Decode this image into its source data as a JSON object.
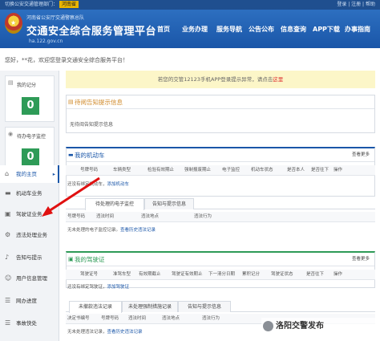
{
  "topbar": {
    "left": "切换公安交通管理部门：",
    "province": "河南省",
    "right": "登录 | 注册 | 帮助"
  },
  "header": {
    "subtitle": "河南省公安厅交通警察总队",
    "title": "交通安全综合服务管理平台",
    "url": "ha.122.gov.cn",
    "nav": [
      "首页",
      "业务办理",
      "服务导航",
      "公告公布",
      "信息查询",
      "APP下载",
      "办事指南"
    ]
  },
  "welcome": "您好，**花，欢迎您登录交通安全综合服务平台！",
  "sidebar": {
    "score_card": {
      "label": "我的记分",
      "value": "0"
    },
    "camera_card": {
      "label": "待办电子监控",
      "value": "0"
    },
    "items": [
      {
        "label": "我的主页",
        "icon": "home-icon",
        "active": true
      },
      {
        "label": "机动车业务",
        "icon": "car-icon"
      },
      {
        "label": "驾驶证业务",
        "icon": "license-icon"
      },
      {
        "label": "违法处理业务",
        "icon": "gear-icon"
      },
      {
        "label": "告知与提示",
        "icon": "bell-icon"
      },
      {
        "label": "用户信息管理",
        "icon": "user-icon"
      },
      {
        "label": "网办进度",
        "icon": "list-icon"
      },
      {
        "label": "事故快处",
        "icon": "list-icon"
      }
    ]
  },
  "notice": {
    "text": "若您的交管12123手机APP登录提示异常，请点击",
    "link": "这里"
  },
  "pending": {
    "title": "待阅告知提示信息",
    "empty": "无待阅告知提示信息"
  },
  "vehicles": {
    "title": "我的机动车",
    "more": "查看更多",
    "columns": [
      "号牌号码",
      "车辆类型",
      "检验有效期止",
      "强制报废期止",
      "电子监控",
      "机动车状态",
      "是否本人",
      "是否往下",
      "操作"
    ],
    "empty_text": "还没有绑定机动车，",
    "empty_link": "添加机动车"
  },
  "vehicle_tabs": [
    "待处理的电子监控",
    "告知与提示信息"
  ],
  "monitor": {
    "columns": [
      "号牌号码",
      "违法时间",
      "违法地点",
      "违法行为"
    ],
    "empty_text": "无未处理的电子监控记录。",
    "empty_link": "查看历史违法记录"
  },
  "license": {
    "title": "我的驾驶证",
    "more": "查看更多",
    "columns": [
      "驾驶证号",
      "准驾车型",
      "有效期截止",
      "驾驶证有效期止",
      "下一清分日期",
      "累积记分",
      "驾驶证状态",
      "是否往下",
      "操作"
    ],
    "empty_text": "还没有绑定驾驶证，",
    "empty_link": "添加驾驶证"
  },
  "license_tabs": [
    "未撤款违法记录",
    "未处理强制措施记录",
    "告知与提示信息"
  ],
  "violations": {
    "columns": [
      "决定书编号",
      "号牌号码",
      "违法时间",
      "违法地点",
      "违法行为"
    ],
    "empty_text": "无未处理违法记录，",
    "empty_link": "查看历史违法记录"
  },
  "watermark": "洛阳交警发布"
}
